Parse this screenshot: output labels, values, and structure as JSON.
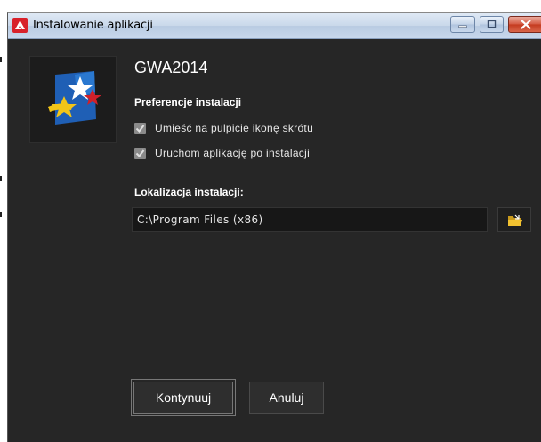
{
  "window": {
    "title": "Instalowanie aplikacji"
  },
  "app": {
    "name": "GWA2014"
  },
  "preferences": {
    "heading": "Preferencje instalacji",
    "options": [
      {
        "label": "Umieść na pulpicie ikonę skrótu",
        "checked": true
      },
      {
        "label": "Uruchom aplikację po instalacji",
        "checked": true
      }
    ]
  },
  "location": {
    "label": "Lokalizacja instalacji:",
    "path": "C:\\Program Files (x86)"
  },
  "buttons": {
    "continue": "Kontynuuj",
    "cancel": "Anuluj"
  },
  "icons": {
    "app": "air-installer-icon",
    "logo": "eu-star-flag-logo",
    "browse": "folder-icon"
  },
  "colors": {
    "background": "#262626",
    "text": "#ffffff",
    "checkbox": "#8a8a8a",
    "close_button": "#c43a1f"
  }
}
